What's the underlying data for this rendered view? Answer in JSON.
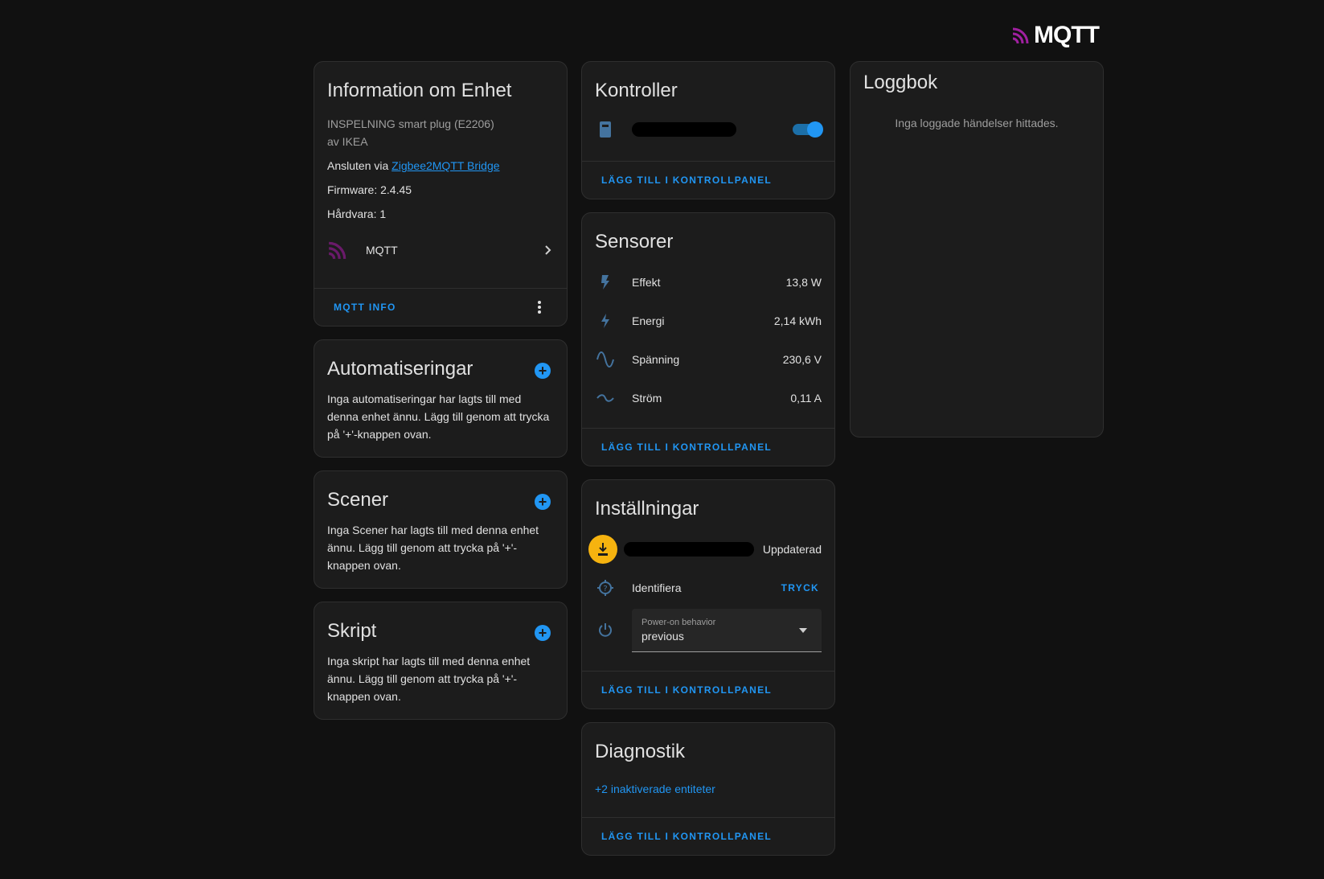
{
  "logo": {
    "text": "MQTT"
  },
  "device_info": {
    "title": "Information om Enhet",
    "model": "INSPELNING smart plug (E2206)",
    "manufacturer": "av IKEA",
    "connected_prefix": "Ansluten via ",
    "connected_link": "Zigbee2MQTT Bridge",
    "firmware": "Firmware: 2.4.45",
    "hardware": "Hårdvara: 1",
    "integration_label": "MQTT",
    "action_label": "MQTT INFO"
  },
  "automations": {
    "title": "Automatiseringar",
    "text": "Inga automatiseringar har lagts till med denna enhet ännu. Lägg till genom att trycka på '+'-knappen ovan."
  },
  "scenes": {
    "title": "Scener",
    "text": "Inga Scener har lagts till med denna enhet ännu. Lägg till genom att trycka på '+'-knappen ovan."
  },
  "scripts": {
    "title": "Skript",
    "text": "Inga skript har lagts till med denna enhet ännu. Lägg till genom att trycka på '+'-knappen ovan."
  },
  "controls": {
    "title": "Kontroller",
    "switch_on": true,
    "action_label": "LÄGG TILL I KONTROLLPANEL"
  },
  "sensors": {
    "title": "Sensorer",
    "items": [
      {
        "name": "Effekt",
        "value": "13,8 W",
        "icon": "flash-icon"
      },
      {
        "name": "Energi",
        "value": "2,14 kWh",
        "icon": "lightning-icon"
      },
      {
        "name": "Spänning",
        "value": "230,6 V",
        "icon": "sine-wave-icon"
      },
      {
        "name": "Ström",
        "value": "0,11 A",
        "icon": "current-ac-icon"
      }
    ],
    "action_label": "LÄGG TILL I KONTROLLPANEL"
  },
  "settings": {
    "title": "Inställningar",
    "update_status": "Uppdaterad",
    "identify_label": "Identifiera",
    "identify_button": "TRYCK",
    "select_label": "Power-on behavior",
    "select_value": "previous",
    "action_label": "LÄGG TILL I KONTROLLPANEL"
  },
  "diagnostics": {
    "title": "Diagnostik",
    "link": "+2 inaktiverade entiteter",
    "action_label": "LÄGG TILL I KONTROLLPANEL"
  },
  "logbook": {
    "title": "Loggbok",
    "empty": "Inga loggade händelser hittades."
  },
  "colors": {
    "accent": "#2196f3",
    "card": "#1c1c1c",
    "background": "#111111"
  }
}
